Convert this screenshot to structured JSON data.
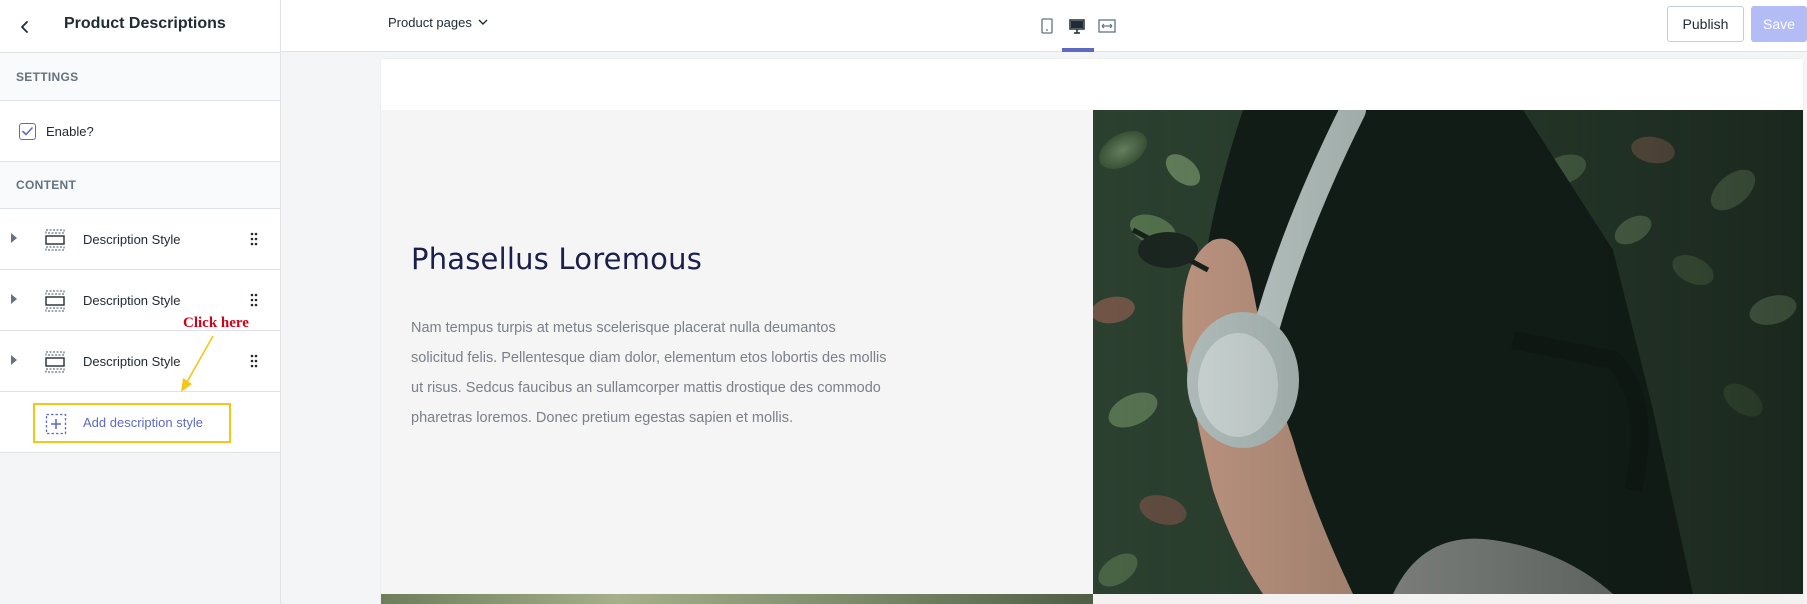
{
  "sidebar": {
    "title": "Product Descriptions",
    "settings_label": "SETTINGS",
    "enable_label": "Enable?",
    "enable_checked": true,
    "content_label": "CONTENT",
    "items": [
      {
        "label": "Description Style"
      },
      {
        "label": "Description Style"
      },
      {
        "label": "Description Style"
      }
    ],
    "add_label": "Add description style"
  },
  "annotation": {
    "text": "Click here",
    "color": "#d0021b",
    "box_color": "#f5c518"
  },
  "topbar": {
    "page_select": "Product pages",
    "devices": [
      "mobile-icon",
      "desktop-icon",
      "fullwidth-icon"
    ],
    "active_device": "desktop-icon",
    "publish_label": "Publish",
    "save_label": "Save"
  },
  "preview": {
    "title": "Phasellus Loremous",
    "body": "Nam tempus turpis at metus scelerisque placerat nulla deumantos solicitud felis. Pellentesque diam dolor, elementum etos lobortis des mollis ut risus. Sedcus faucibus an sullamcorper mattis drostique des commodo pharetras loremos. Donec pretium egestas sapien et mollis."
  },
  "colors": {
    "accent": "#5c6ac4",
    "save_disabled": "#b3bcf5",
    "title": "#1a1f4b"
  }
}
